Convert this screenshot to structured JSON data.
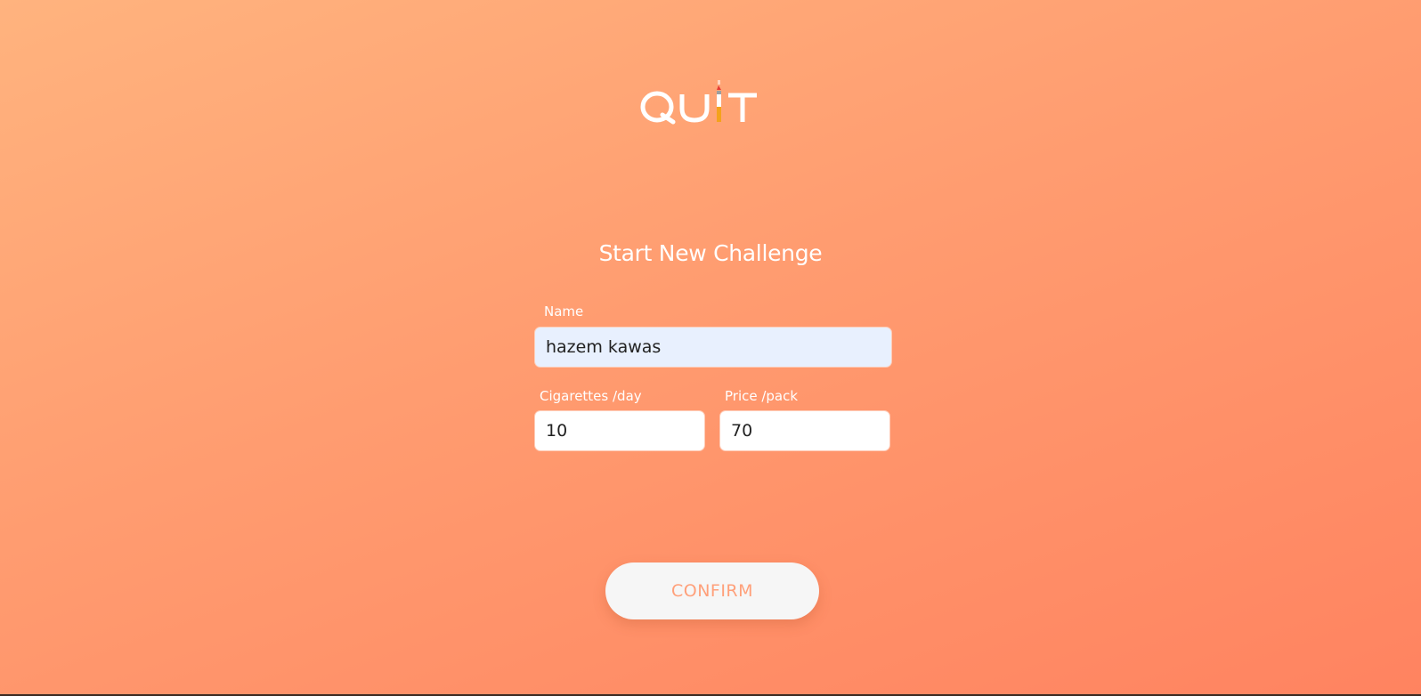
{
  "app": {
    "logo_text": "QUIT"
  },
  "form": {
    "title": "Start New Challenge",
    "name_label": "Name",
    "name_value": "hazem kawas",
    "cigarettes_label": "Cigarettes /day",
    "cigarettes_value": "10",
    "price_label": "Price /pack",
    "price_value": "70",
    "confirm_label": "CONFIRM"
  },
  "colors": {
    "background_start": "#ffb37e",
    "background_end": "#ff8360",
    "name_field_bg": "#e8f0fe",
    "button_bg": "#f6f6f6",
    "button_text": "#ffa07a",
    "cigarette_filter": "#f4a21c"
  },
  "icons": {
    "logo": "cigarette-i-icon"
  }
}
